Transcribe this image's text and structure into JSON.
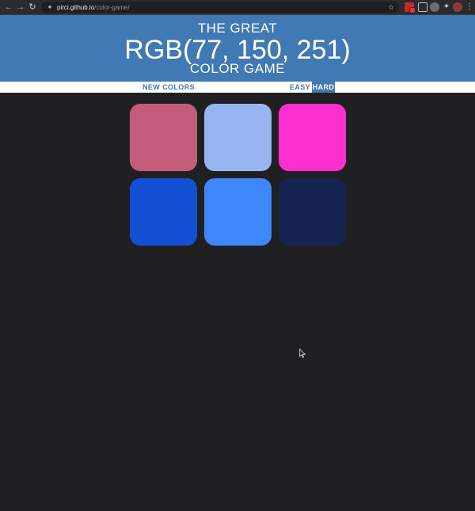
{
  "browser": {
    "url_host": "pirci.github.io",
    "url_path": "/color-game/"
  },
  "header": {
    "line1": "THE GREAT",
    "target_rgb": "RGB(77, 150, 251)",
    "line3": "COLOR GAME"
  },
  "stripe": {
    "new_colors_label": "NEW COLORS",
    "easy_label": "EASY",
    "hard_label": "HARD",
    "selected_mode": "HARD"
  },
  "squares": [
    {
      "color": "#c25c7a"
    },
    {
      "color": "#98b5f2"
    },
    {
      "color": "#fe2fcf"
    },
    {
      "color": "#1450d4"
    },
    {
      "color": "#3e87fb"
    },
    {
      "color": "#172350"
    }
  ],
  "colors": {
    "header_bg": "#4079b4",
    "page_bg": "#202022"
  }
}
